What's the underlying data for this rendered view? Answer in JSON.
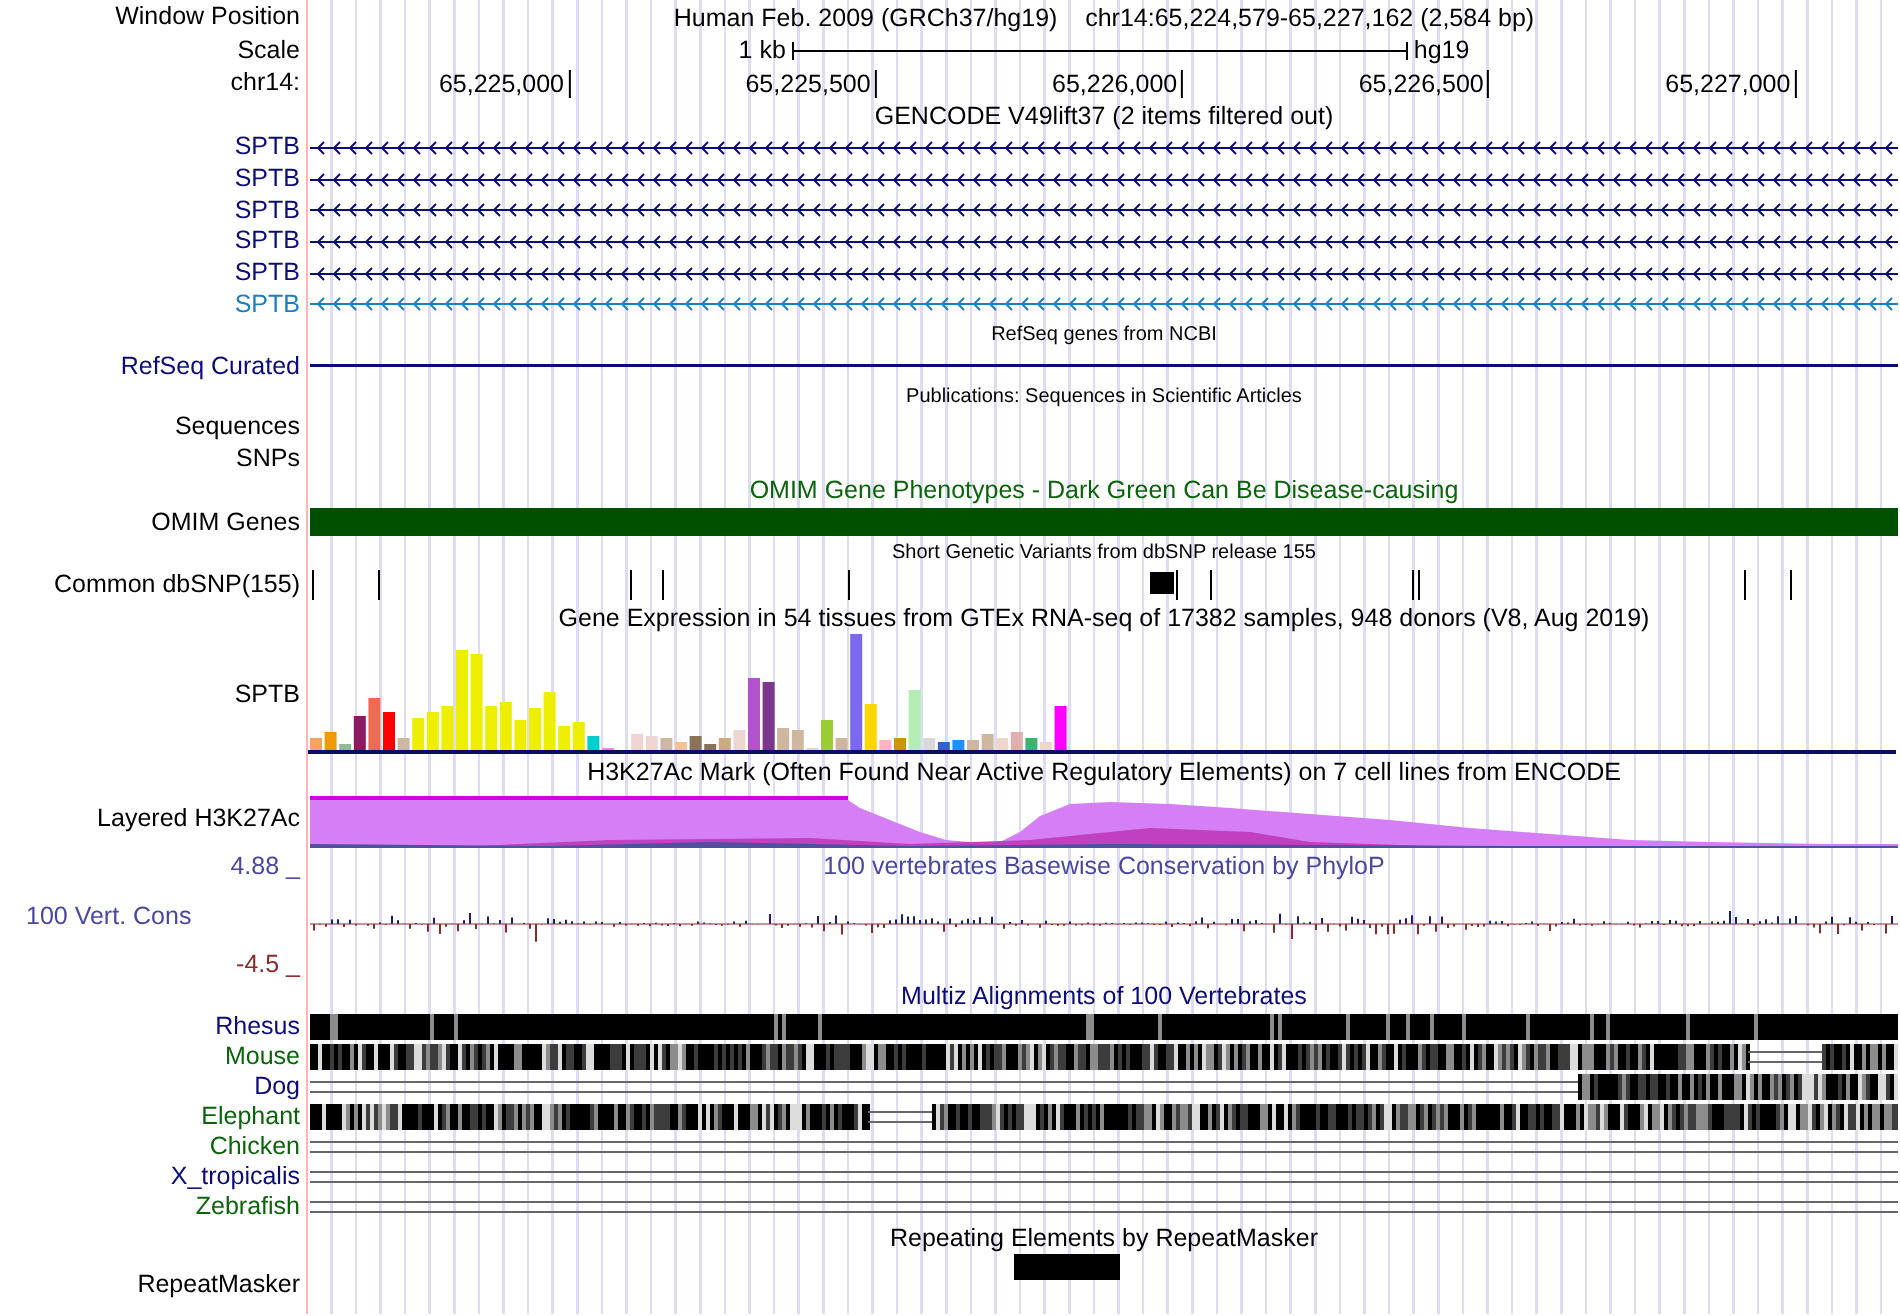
{
  "rows": [
    {
      "kind": "position",
      "label": "Window Position",
      "assembly": "Human Feb. 2009 (GRCh37/hg19)",
      "range": "chr14:65,224,579-65,227,162 (2,584 bp)"
    },
    {
      "kind": "scale",
      "label": "Scale",
      "span": "1 kb",
      "db": "hg19"
    },
    {
      "kind": "ruler",
      "label": "chr14:",
      "ticks": [
        "65,225,000",
        "65,225,500",
        "65,226,000",
        "65,226,500",
        "65,227,000"
      ]
    },
    {
      "kind": "title",
      "text": "GENCODE V49lift37 (2 items filtered out)",
      "color": "#000000"
    },
    {
      "kind": "gene",
      "label": "SPTB",
      "color": "#0c0c78"
    },
    {
      "kind": "gene",
      "label": "SPTB",
      "color": "#0c0c78"
    },
    {
      "kind": "gene",
      "label": "SPTB",
      "color": "#0c0c78"
    },
    {
      "kind": "gene",
      "label": "SPTB",
      "color": "#0c0c78"
    },
    {
      "kind": "gene",
      "label": "SPTB",
      "color": "#0c0c78"
    },
    {
      "kind": "gene",
      "label": "SPTB",
      "color": "#1a7fc0"
    },
    {
      "kind": "note",
      "text": "RefSeq genes from NCBI"
    },
    {
      "kind": "line",
      "label": "RefSeq Curated",
      "color": "#0c0c78"
    },
    {
      "kind": "note",
      "text": "Publications: Sequences in Scientific Articles"
    },
    {
      "kind": "empty",
      "label": "Sequences"
    },
    {
      "kind": "empty",
      "label": "SNPs"
    },
    {
      "kind": "title",
      "text": "OMIM Gene Phenotypes - Dark Green Can Be Disease-causing",
      "color": "#0a640a"
    },
    {
      "kind": "bar",
      "label": "OMIM Genes",
      "color": "#005000"
    },
    {
      "kind": "note",
      "text": "Short Genetic Variants from dbSNP release 155"
    },
    {
      "kind": "snp",
      "label": "Common dbSNP(155)"
    },
    {
      "kind": "title",
      "text": "Gene Expression in 54 tissues from GTEx RNA-seq of 17382 samples, 948 donors (V8, Aug 2019)",
      "color": "#000000"
    },
    {
      "kind": "expression",
      "label": "SPTB"
    },
    {
      "kind": "title",
      "text": "H3K27Ac Mark (Often Found Near Active Regulatory Elements) on 7 cell lines from ENCODE",
      "color": "#000000"
    },
    {
      "kind": "area",
      "label": "Layered H3K27Ac"
    },
    {
      "kind": "wiggle",
      "label": "100 Vert. Cons",
      "max": "4.88 _",
      "min": "-4.5 _",
      "title": "100 vertebrates Basewise Conservation by PhyloP"
    },
    {
      "kind": "title",
      "text": "Multiz Alignments of 100 Vertebrates",
      "color": "#0c0c78"
    },
    {
      "kind": "species",
      "label": "Rhesus",
      "color": "#0c0c78"
    },
    {
      "kind": "species",
      "label": "Mouse",
      "color": "#0a640a"
    },
    {
      "kind": "species",
      "label": "Dog",
      "color": "#0c0c78"
    },
    {
      "kind": "species",
      "label": "Elephant",
      "color": "#0a640a"
    },
    {
      "kind": "species",
      "label": "Chicken",
      "color": "#0a640a"
    },
    {
      "kind": "species",
      "label": "X_tropicalis",
      "color": "#0c0c78"
    },
    {
      "kind": "species",
      "label": "Zebrafish",
      "color": "#0a640a"
    },
    {
      "kind": "title",
      "text": "Repeating Elements by RepeatMasker",
      "color": "#000000"
    },
    {
      "kind": "repeat",
      "label": "RepeatMasker"
    }
  ]
}
